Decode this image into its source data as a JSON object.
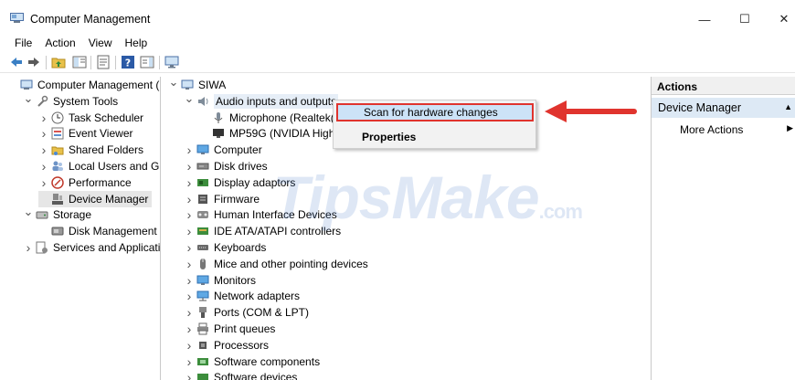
{
  "window": {
    "title": "Computer Management",
    "controls": {
      "minimize": "—",
      "maximize": "☐",
      "close": "✕"
    }
  },
  "menu": [
    "File",
    "Action",
    "View",
    "Help"
  ],
  "left_tree": [
    {
      "label": "Computer Management (Lo",
      "indent": 0,
      "chevron": "",
      "icon": "computer-management-icon"
    },
    {
      "label": "System Tools",
      "indent": 1,
      "chevron": "down",
      "icon": "system-tools-icon"
    },
    {
      "label": "Task Scheduler",
      "indent": 2,
      "chevron": "right",
      "icon": "clock-icon"
    },
    {
      "label": "Event Viewer",
      "indent": 2,
      "chevron": "right",
      "icon": "event-viewer-icon"
    },
    {
      "label": "Shared Folders",
      "indent": 2,
      "chevron": "right",
      "icon": "shared-folder-icon"
    },
    {
      "label": "Local Users and Grou",
      "indent": 2,
      "chevron": "right",
      "icon": "users-icon"
    },
    {
      "label": "Performance",
      "indent": 2,
      "chevron": "right",
      "icon": "performance-icon"
    },
    {
      "label": "Device Manager",
      "indent": 2,
      "chevron": "",
      "icon": "device-manager-icon",
      "selected": true
    },
    {
      "label": "Storage",
      "indent": 1,
      "chevron": "down",
      "icon": "storage-icon"
    },
    {
      "label": "Disk Management",
      "indent": 2,
      "chevron": "",
      "icon": "disk-management-icon"
    },
    {
      "label": "Services and Application",
      "indent": 1,
      "chevron": "right",
      "icon": "services-icon"
    }
  ],
  "device_tree": [
    {
      "label": "SIWA",
      "indent": 0,
      "chevron": "down",
      "icon": "computer-icon"
    },
    {
      "label": "Audio inputs and outputs",
      "indent": 1,
      "chevron": "down",
      "icon": "speaker-icon",
      "highlight": true
    },
    {
      "label": "Microphone (Realtek(R",
      "indent": 2,
      "chevron": "",
      "icon": "microphone-icon"
    },
    {
      "label": "MP59G (NVIDIA High",
      "indent": 2,
      "chevron": "",
      "icon": "monitor-speaker-icon"
    },
    {
      "label": "Computer",
      "indent": 1,
      "chevron": "right",
      "icon": "monitor-icon"
    },
    {
      "label": "Disk drives",
      "indent": 1,
      "chevron": "right",
      "icon": "disk-drive-icon"
    },
    {
      "label": "Display adaptors",
      "indent": 1,
      "chevron": "right",
      "icon": "display-adapter-icon"
    },
    {
      "label": "Firmware",
      "indent": 1,
      "chevron": "right",
      "icon": "firmware-icon"
    },
    {
      "label": "Human Interface Devices",
      "indent": 1,
      "chevron": "right",
      "icon": "hid-icon"
    },
    {
      "label": "IDE ATA/ATAPI controllers",
      "indent": 1,
      "chevron": "right",
      "icon": "ide-controller-icon"
    },
    {
      "label": "Keyboards",
      "indent": 1,
      "chevron": "right",
      "icon": "keyboard-icon"
    },
    {
      "label": "Mice and other pointing devices",
      "indent": 1,
      "chevron": "right",
      "icon": "mouse-icon"
    },
    {
      "label": "Monitors",
      "indent": 1,
      "chevron": "right",
      "icon": "monitor-icon"
    },
    {
      "label": "Network adapters",
      "indent": 1,
      "chevron": "right",
      "icon": "network-icon"
    },
    {
      "label": "Ports (COM & LPT)",
      "indent": 1,
      "chevron": "right",
      "icon": "port-icon"
    },
    {
      "label": "Print queues",
      "indent": 1,
      "chevron": "right",
      "icon": "printer-icon"
    },
    {
      "label": "Processors",
      "indent": 1,
      "chevron": "right",
      "icon": "processor-icon"
    },
    {
      "label": "Software components",
      "indent": 1,
      "chevron": "right",
      "icon": "software-component-icon"
    },
    {
      "label": "Software devices",
      "indent": 1,
      "chevron": "right",
      "icon": "software-device-icon"
    }
  ],
  "context_menu": {
    "scan": "Scan for hardware changes",
    "properties": "Properties"
  },
  "actions": {
    "header": "Actions",
    "section": "Device Manager",
    "more": "More Actions"
  },
  "watermark": {
    "brand": "TipsMake",
    "suffix": ".com"
  },
  "colors": {
    "annotation_red": "#e0342e",
    "selection_blue": "#cce3f7",
    "actions_band": "#dde9f5"
  }
}
